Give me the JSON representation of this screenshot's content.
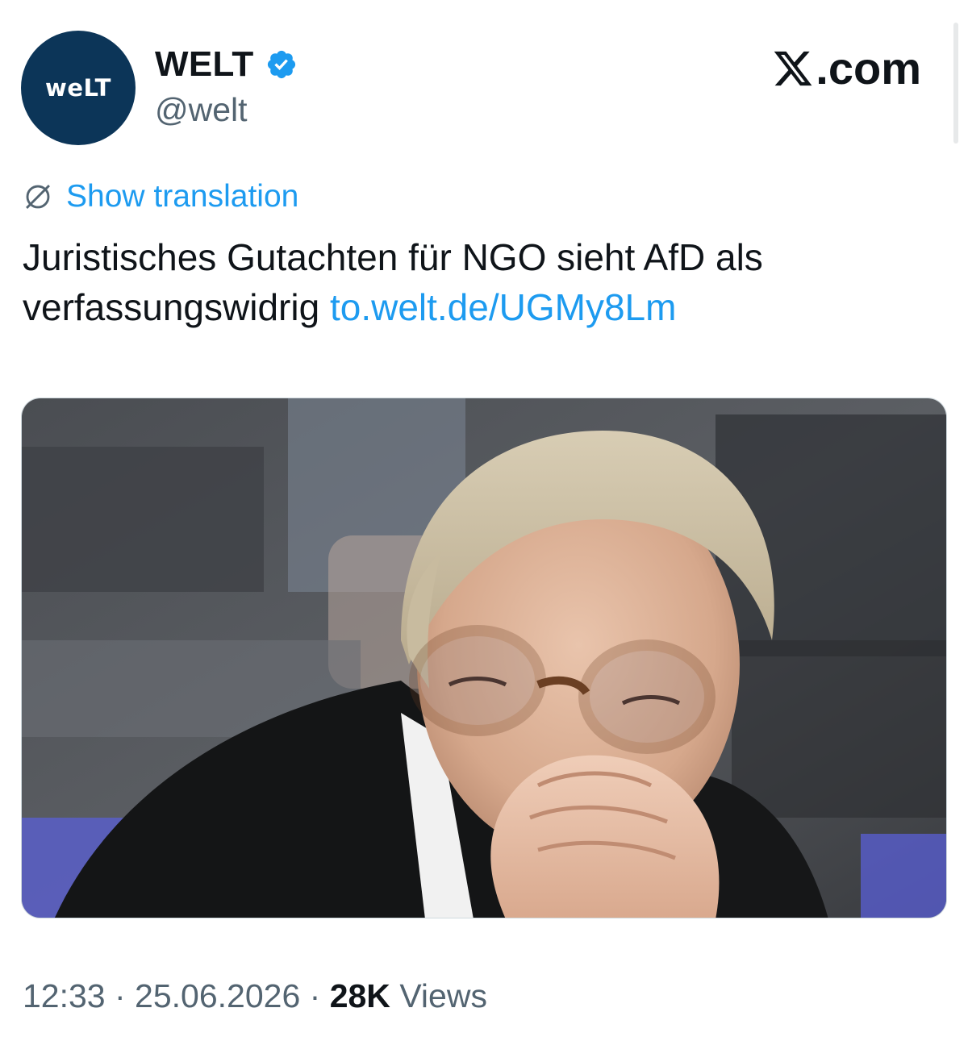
{
  "account": {
    "avatar_text": "weLT",
    "display_name": "WELT",
    "handle": "@welt",
    "verified_icon": "verified-badge-icon",
    "brand_color": "#0c3558"
  },
  "site": {
    "brand_suffix": ".com",
    "logo_icon": "x-logo-icon"
  },
  "translation": {
    "label": "Show translation",
    "icon": "translate-icon",
    "color": "#1d9bf0"
  },
  "tweet": {
    "text": "Juristisches Gutachten für NGO sieht AfD als verfassungswidrig",
    "link": "to.welt.de/UGMy8Lm",
    "link_color": "#1d9bf0"
  },
  "media": {
    "kind": "photo"
  },
  "meta": {
    "time": "12:33",
    "separator": " · ",
    "date": "25.06.2026",
    "views_count": "28K",
    "views_label": "Views"
  }
}
